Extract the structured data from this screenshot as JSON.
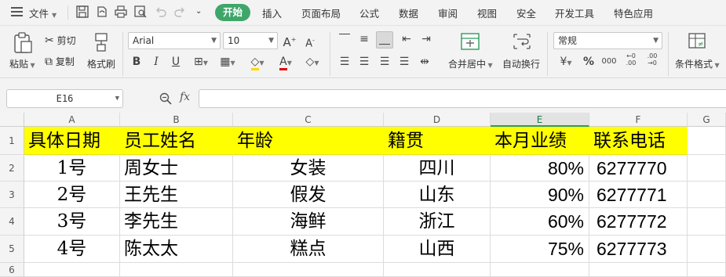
{
  "menu": {
    "file_label": "文件",
    "tabs": [
      "开始",
      "插入",
      "页面布局",
      "公式",
      "数据",
      "审阅",
      "视图",
      "安全",
      "开发工具",
      "特色应用"
    ],
    "active_tab": "开始"
  },
  "ribbon": {
    "paste_label": "粘贴",
    "cut_label": "剪切",
    "copy_label": "复制",
    "format_painter_label": "格式刷",
    "font_name": "Arial",
    "font_size": "10",
    "merge_center_label": "合并居中",
    "wrap_text_label": "自动换行",
    "number_format": "常规",
    "conditional_format_label": "条件格式"
  },
  "formula_bar": {
    "name_box": "E16",
    "fx_label": "fx",
    "formula": ""
  },
  "sheet": {
    "columns": [
      "A",
      "B",
      "C",
      "D",
      "E",
      "F",
      "G"
    ],
    "selected_column": "E",
    "rows": [
      "1",
      "2",
      "3",
      "4",
      "5",
      "6"
    ],
    "header": [
      "具体日期",
      "员工姓名",
      "年龄",
      "籍贯",
      "本月业绩",
      "联系电话"
    ],
    "data": [
      [
        "1号",
        "周女士",
        "女装",
        "四川",
        "80%",
        "6277770"
      ],
      [
        "2号",
        "王先生",
        "假发",
        "山东",
        "90%",
        "6277771"
      ],
      [
        "3号",
        "李先生",
        "海鲜",
        "浙江",
        "60%",
        "6277772"
      ],
      [
        "4号",
        "陈太太",
        "糕点",
        "山西",
        "75%",
        "6277773"
      ]
    ],
    "header_color": "#ffff00",
    "accent_color": "#3fa66a"
  }
}
